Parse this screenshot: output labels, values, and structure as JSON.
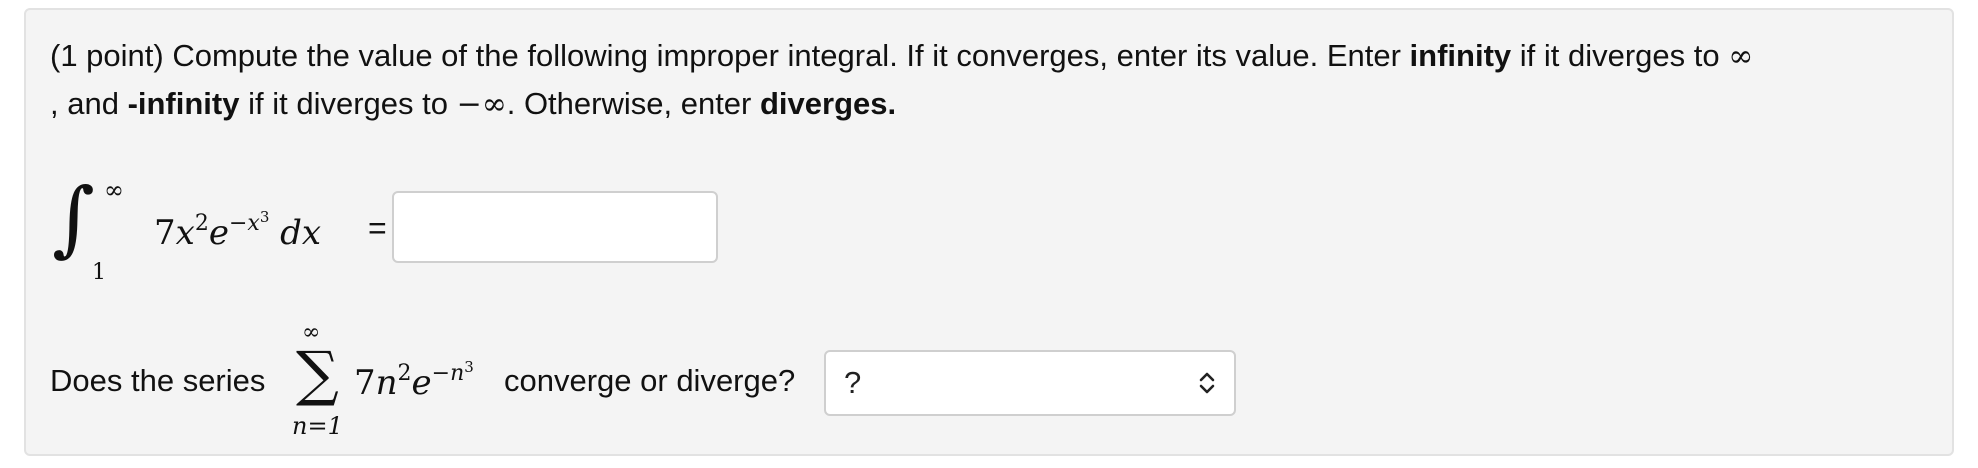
{
  "problem": {
    "points": "(1 point)",
    "intro": " Compute the value of the following improper integral. If it converges, enter its value. Enter ",
    "infinity_kw": "infinity",
    "mid1": " if it diverges to ",
    "inf_symbol": "∞",
    "line2_prefix": ", and ",
    "neg_infinity_kw": "-infinity",
    "mid2": " if it diverges to ",
    "neg_inf_symbol": "−∞",
    "mid3": ". Otherwise, enter ",
    "diverges_kw": "diverges."
  },
  "integral": {
    "sign": "∫",
    "upper": "∞",
    "lower": "1",
    "coef": "7",
    "var": "x",
    "var_exp": "2",
    "base": "e",
    "exp_sign": "−",
    "exp_var": "x",
    "exp_pow": "3",
    "differential": "dx",
    "equals": "=",
    "answer_value": ""
  },
  "series": {
    "lead": "Does the series",
    "sigma": "∑",
    "upper": "∞",
    "lower": "n=1",
    "coef": "7",
    "var": "n",
    "var_exp": "2",
    "base": "e",
    "exp_sign": "−",
    "exp_var": "n",
    "exp_pow": "3",
    "tail": "converge or diverge?",
    "select_value": "?"
  },
  "icons": {
    "select_arrows": "up-down-chevron-icon"
  }
}
